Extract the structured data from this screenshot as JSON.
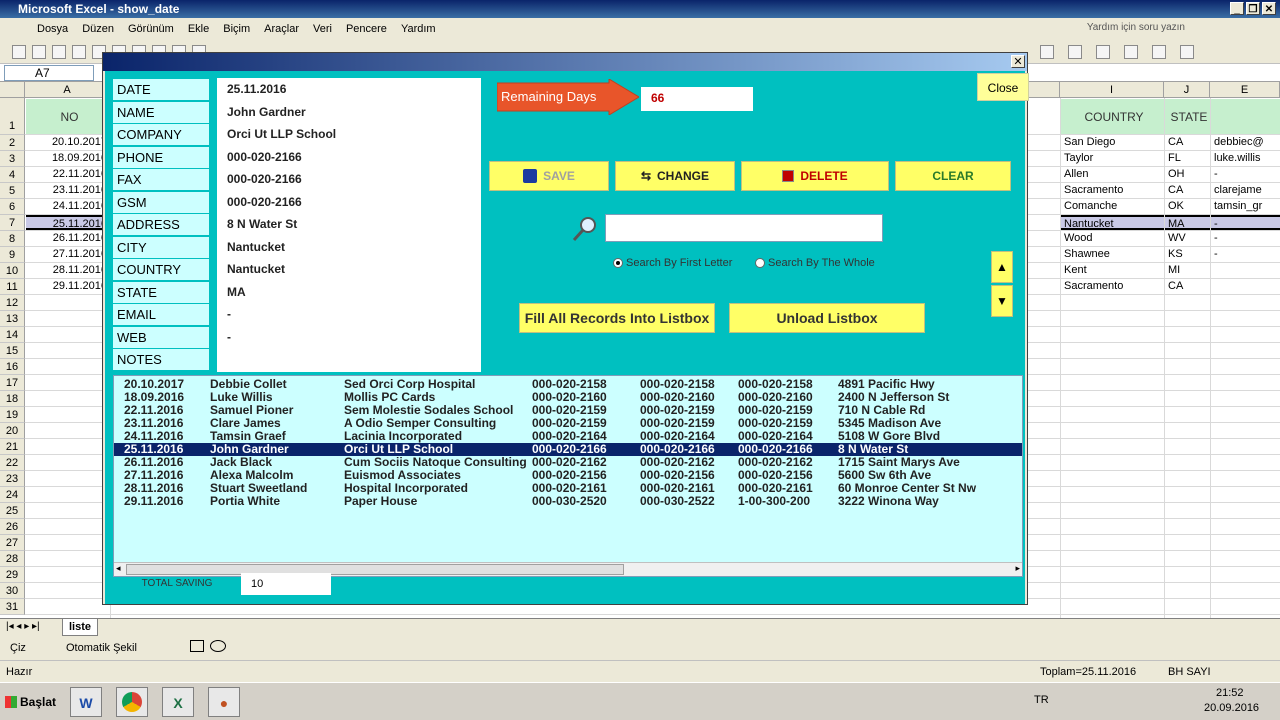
{
  "window": {
    "title": "Microsoft Excel - show_date"
  },
  "menu": [
    "Dosya",
    "Düzen",
    "Görünüm",
    "Ekle",
    "Biçim",
    "Araçlar",
    "Veri",
    "Pencere",
    "Yardım"
  ],
  "help_placeholder": "Yardım için soru yazın",
  "namebox": "A7",
  "sheet": {
    "col_letters": [
      "A",
      "I",
      "J",
      "E"
    ],
    "header_row": {
      "no": "NO",
      "country": "COUNTRY",
      "state": "STATE"
    },
    "row_numbers": [
      "1",
      "2",
      "3",
      "4",
      "5",
      "6",
      "7",
      "8",
      "9",
      "10",
      "11",
      "12",
      "13",
      "14",
      "15",
      "16",
      "17",
      "18",
      "19",
      "20",
      "21",
      "22",
      "23",
      "24",
      "25",
      "26",
      "27",
      "28",
      "29",
      "30",
      "31"
    ],
    "col_a": [
      "20.10.2017",
      "18.09.2016",
      "22.11.2016",
      "23.11.2016",
      "24.11.2016",
      "25.11.2016",
      "26.11.2016",
      "27.11.2016",
      "28.11.2016",
      "29.11.2016"
    ],
    "col_i": [
      "San Diego",
      "Taylor",
      "Allen",
      "Sacramento",
      "Comanche",
      "Nantucket",
      "Wood",
      "Shawnee",
      "Kent",
      "Sacramento"
    ],
    "col_j": [
      "CA",
      "FL",
      "OH",
      "CA",
      "OK",
      "MA",
      "WV",
      "KS",
      "MI",
      "CA"
    ],
    "col_k": [
      "debbiec@",
      "luke.willis",
      "-",
      "clarejame",
      "tamsin_gr",
      "-",
      "-",
      "-",
      "",
      ""
    ],
    "tab": "liste"
  },
  "form": {
    "labels": [
      "DATE",
      "NAME",
      "COMPANY",
      "PHONE",
      "FAX",
      "GSM",
      "ADDRESS",
      "CITY",
      "COUNTRY",
      "STATE",
      "EMAIL",
      "WEB",
      "NOTES"
    ],
    "values": [
      "25.11.2016",
      "John Gardner",
      "Orci Ut LLP School",
      "000-020-2166",
      "000-020-2166",
      "000-020-2166",
      "8 N Water St",
      "Nantucket",
      "Nantucket",
      "MA",
      "-",
      "-",
      ""
    ],
    "remaining_label": "Remaining Days",
    "remaining_value": "66",
    "close_label": "Close",
    "buttons": {
      "save": "SAVE",
      "change": "CHANGE",
      "delete": "DELETE",
      "clear": "CLEAR"
    },
    "search_value": "",
    "radio_first": "Search By First Letter",
    "radio_whole": "Search By The Whole",
    "fill_btn": "Fill All Records Into Listbox",
    "unload_btn": "Unload Listbox",
    "total_label": "TOTAL SAVING",
    "total_value": "10"
  },
  "listbox": {
    "rows": [
      [
        "20.10.2017",
        "Debbie Collet",
        "Sed Orci Corp Hospital",
        "000-020-2158",
        "000-020-2158",
        "000-020-2158",
        "4891 Pacific Hwy"
      ],
      [
        "18.09.2016",
        "Luke Willis",
        "Mollis PC Cards",
        "000-020-2160",
        "000-020-2160",
        "000-020-2160",
        "2400 N Jefferson St"
      ],
      [
        "22.11.2016",
        "Samuel Pioner",
        "Sem Molestie Sodales School",
        "000-020-2159",
        "000-020-2159",
        "000-020-2159",
        "710 N Cable Rd"
      ],
      [
        "23.11.2016",
        "Clare James",
        "A Odio Semper Consulting",
        "000-020-2159",
        "000-020-2159",
        "000-020-2159",
        "5345 Madison Ave"
      ],
      [
        "24.11.2016",
        "Tamsin Graef",
        "Lacinia  Incorporated",
        "000-020-2164",
        "000-020-2164",
        "000-020-2164",
        "5108 W Gore Blvd"
      ],
      [
        "25.11.2016",
        "John Gardner",
        "Orci Ut LLP School",
        "000-020-2166",
        "000-020-2166",
        "000-020-2166",
        "8 N Water St"
      ],
      [
        "26.11.2016",
        "Jack Black",
        "Cum Sociis Natoque Consulting",
        "000-020-2162",
        "000-020-2162",
        "000-020-2162",
        "1715 Saint Marys Ave"
      ],
      [
        "27.11.2016",
        "Alexa Malcolm",
        "Euismod Associates",
        "000-020-2156",
        "000-020-2156",
        "000-020-2156",
        "5600 Sw 6th Ave"
      ],
      [
        "28.11.2016",
        "Stuart Sweetland",
        " Hospital Incorporated",
        "000-020-2161",
        "000-020-2161",
        "000-020-2161",
        "60 Monroe Center St Nw"
      ],
      [
        "29.11.2016",
        "Portia White",
        "Paper House",
        "000-030-2520",
        "000-030-2522",
        "1-00-300-200",
        "3222 Winona Way"
      ]
    ],
    "selected_index": 5
  },
  "status": {
    "ready": "Hazır",
    "sum": "Toplam=25.11.2016",
    "mode": "BH SAYI"
  },
  "drawbar": {
    "draw": "Çiz",
    "autoshapes": "Otomatik Şekil"
  },
  "taskbar": {
    "start": "Başlat",
    "lang": "TR",
    "time": "21:52",
    "date": "20.09.2016"
  },
  "colors": {
    "dialog_bg": "#00c0c0",
    "label_bg": "#ccffff",
    "button_yellow": "#ffff66",
    "arrow": "#e8552a"
  }
}
